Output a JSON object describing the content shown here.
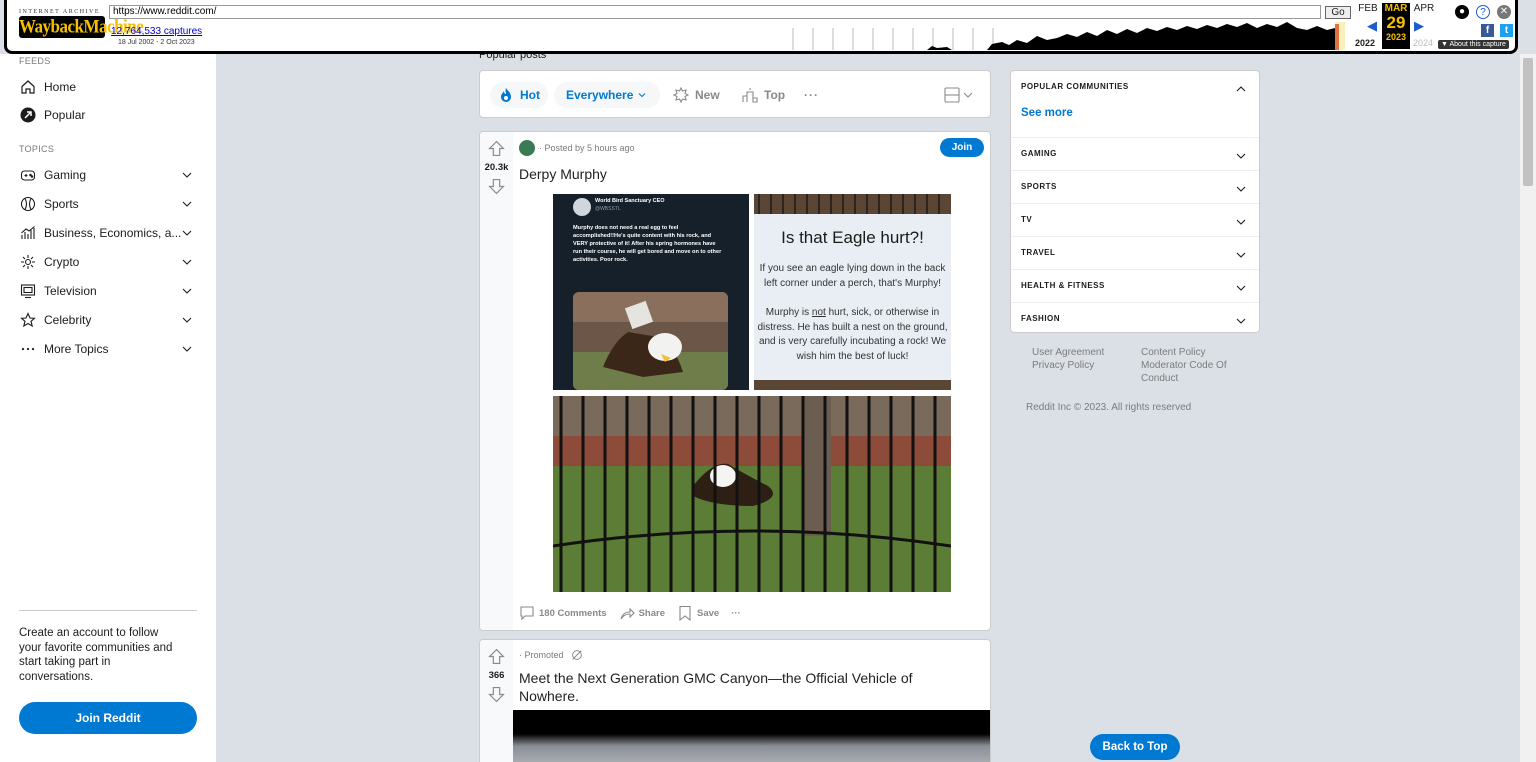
{
  "wayback": {
    "logo_top": "INTERNET ARCHIVE",
    "logo_main": "WaybackMachine",
    "url": "https://www.reddit.com/",
    "go_label": "Go",
    "captures": "12,764,533 captures",
    "range": "18 Jul 2002 - 2 Oct 2023",
    "prev_month": "FEB",
    "cur_month": "MAR",
    "next_month": "APR",
    "cur_day": "29",
    "prev_year": "2022",
    "cur_year": "2023",
    "next_year": "2024",
    "about": "▼ About this capture"
  },
  "sidebar": {
    "feeds_label": "FEEDS",
    "feeds": [
      {
        "label": "Home",
        "icon": "home-icon"
      },
      {
        "label": "Popular",
        "icon": "popular-icon"
      }
    ],
    "topics_label": "TOPICS",
    "topics": [
      {
        "label": "Gaming",
        "icon": "gamepad-icon"
      },
      {
        "label": "Sports",
        "icon": "ball-icon"
      },
      {
        "label": "Business, Economics, a...",
        "icon": "chart-icon"
      },
      {
        "label": "Crypto",
        "icon": "crypto-icon"
      },
      {
        "label": "Television",
        "icon": "tv-icon"
      },
      {
        "label": "Celebrity",
        "icon": "star-icon"
      },
      {
        "label": "More Topics",
        "icon": "dots-icon"
      }
    ],
    "promo": "Create an account to follow your favorite communities and start taking part in conversations.",
    "join_label": "Join Reddit"
  },
  "feed": {
    "section_label": "Popular posts",
    "sort": {
      "hot": "Hot",
      "everywhere": "Everywhere",
      "new": "New",
      "top": "Top",
      "more": "···"
    }
  },
  "post1": {
    "votes": "20.3k",
    "meta": "· Posted by 5 hours ago",
    "title": "Derpy Murphy",
    "join": "Join",
    "tweet_name": "World Bird Sanctuary CEO",
    "tweet_handle": "@WBSSTL",
    "tweet_text": "Murphy does not need a real egg to feel accomplished!!He's quite content with his rock, and VERY protective of it! After his spring hormones have run their course, he will get bored and move on to other activities. Poor rock.",
    "sign_title": "Is that Eagle hurt?!",
    "sign_text1": "If you see an eagle lying down in the back left corner under a perch, that's Murphy!",
    "sign_not": "not",
    "sign_text2_pre": "Murphy is ",
    "sign_text2_post": " hurt, sick, or otherwise in distress. He has built a nest on the ground, and is very carefully incubating a rock! We wish him the best of luck!",
    "comments": "180 Comments",
    "share": "Share",
    "save": "Save",
    "more": "···"
  },
  "post2": {
    "votes": "366",
    "meta": "· Promoted",
    "title": "Meet the Next Generation GMC Canyon—the Official Vehicle of Nowhere."
  },
  "communities": {
    "header": "POPULAR COMMUNITIES",
    "see_more": "See more",
    "items": [
      "GAMING",
      "SPORTS",
      "TV",
      "TRAVEL",
      "HEALTH & FITNESS",
      "FASHION"
    ]
  },
  "footer": {
    "user_agreement": "User Agreement",
    "privacy_policy": "Privacy Policy",
    "content_policy": "Content Policy",
    "moderator_code": "Moderator Code Of Conduct",
    "copyright": "Reddit Inc © 2023. All rights reserved"
  },
  "back_to_top": "Back to Top",
  "colors": {
    "accent": "#0079d3",
    "background": "#dae0e6",
    "wayback_gold": "#f6c000"
  }
}
